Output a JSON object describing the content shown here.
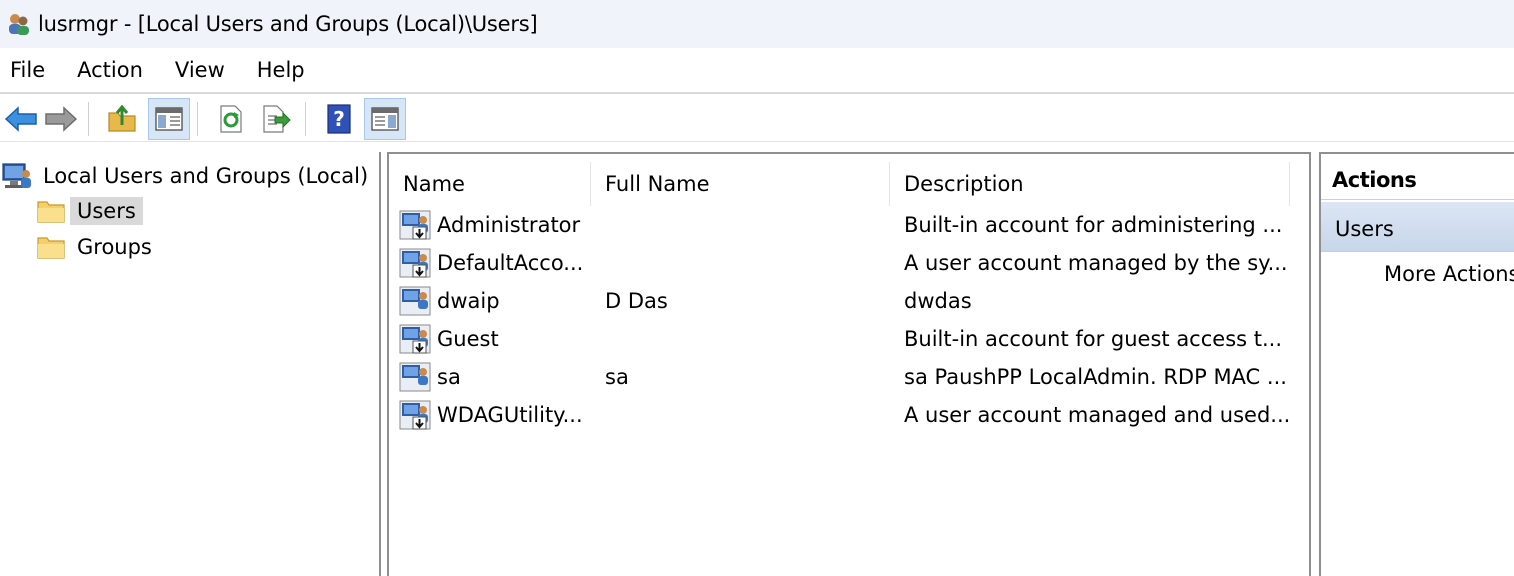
{
  "window": {
    "title": "lusrmgr - [Local Users and Groups (Local)\\Users]",
    "app_icon": "users-groups-icon"
  },
  "menu": [
    "File",
    "Action",
    "View",
    "Help"
  ],
  "toolbar": {
    "buttons": [
      "back-arrow-icon",
      "forward-arrow-icon",
      "up-folder-icon",
      "show-hide-tree-icon",
      "refresh-icon",
      "export-list-icon",
      "help-icon",
      "show-hide-action-pane-icon"
    ]
  },
  "tree": {
    "root": "Local Users and Groups (Local)",
    "children": [
      "Users",
      "Groups"
    ],
    "selected": "Users"
  },
  "list": {
    "columns": [
      "Name",
      "Full Name",
      "Description"
    ],
    "rows": [
      {
        "name": "Administrator",
        "full_name": "",
        "description": "Built-in account for administering ...",
        "disabled": true
      },
      {
        "name": "DefaultAcco...",
        "full_name": "",
        "description": "A user account managed by the sy...",
        "disabled": true
      },
      {
        "name": "dwaip",
        "full_name": "D Das",
        "description": "dwdas",
        "disabled": false
      },
      {
        "name": "Guest",
        "full_name": "",
        "description": "Built-in account for guest access t...",
        "disabled": true
      },
      {
        "name": "sa",
        "full_name": "sa",
        "description": "sa PaushPP LocalAdmin. RDP MAC ...",
        "disabled": false
      },
      {
        "name": "WDAGUtility...",
        "full_name": "",
        "description": "A user account managed and used...",
        "disabled": true
      }
    ]
  },
  "actions": {
    "header": "Actions",
    "section": "Users",
    "item": "More Actions"
  },
  "colors": {
    "titlebar_bg": "#f0f3f9",
    "selection_gray": "#d9d9d9",
    "section_blue": "#c7d6ea"
  }
}
